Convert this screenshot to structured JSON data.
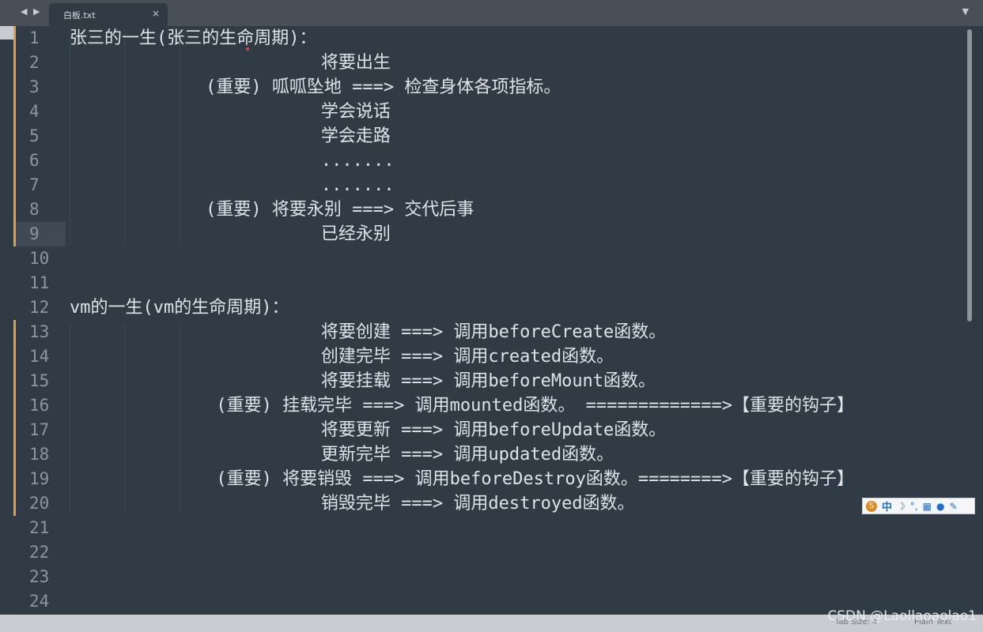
{
  "tab": {
    "nav": "◀ ▶",
    "filename": "白板.txt",
    "close": "×",
    "menu": "▼"
  },
  "lines": [
    {
      "n": "1",
      "t": "张三的一生(张三的生命周期)：",
      "mod": true
    },
    {
      "n": "2",
      "t": "                        将要出生",
      "mod": true
    },
    {
      "n": "3",
      "t": "             (重要) 呱呱坠地 ===> 检查身体各项指标。",
      "mod": true
    },
    {
      "n": "4",
      "t": "                        学会说话",
      "mod": true
    },
    {
      "n": "5",
      "t": "                        学会走路",
      "mod": true
    },
    {
      "n": "6",
      "t": "                        .......",
      "mod": true
    },
    {
      "n": "7",
      "t": "                        .......",
      "mod": true
    },
    {
      "n": "8",
      "t": "             (重要) 将要永别 ===> 交代后事",
      "mod": true
    },
    {
      "n": "9",
      "t": "                        已经永别",
      "mod": true,
      "cur": true
    },
    {
      "n": "10",
      "t": "",
      "mod": false
    },
    {
      "n": "11",
      "t": "",
      "mod": false
    },
    {
      "n": "12",
      "t": "vm的一生(vm的生命周期)：",
      "mod": false
    },
    {
      "n": "13",
      "t": "                        将要创建 ===> 调用beforeCreate函数。",
      "mod": true
    },
    {
      "n": "14",
      "t": "                        创建完毕 ===> 调用created函数。",
      "mod": true
    },
    {
      "n": "15",
      "t": "                        将要挂载 ===> 调用beforeMount函数。",
      "mod": true
    },
    {
      "n": "16",
      "t": "              (重要) 挂载完毕 ===> 调用mounted函数。 =============>【重要的钩子】",
      "mod": true
    },
    {
      "n": "17",
      "t": "                        将要更新 ===> 调用beforeUpdate函数。",
      "mod": true
    },
    {
      "n": "18",
      "t": "                        更新完毕 ===> 调用updated函数。",
      "mod": true
    },
    {
      "n": "19",
      "t": "              (重要) 将要销毁 ===> 调用beforeDestroy函数。========>【重要的钩子】",
      "mod": true
    },
    {
      "n": "20",
      "t": "                        销毁完毕 ===> 调用destroyed函数。",
      "mod": true
    },
    {
      "n": "21",
      "t": "",
      "mod": false
    },
    {
      "n": "22",
      "t": "",
      "mod": false
    },
    {
      "n": "23",
      "t": "",
      "mod": false
    },
    {
      "n": "24",
      "t": "",
      "mod": false
    }
  ],
  "ime": {
    "lang": "中"
  },
  "status": {
    "tab_size": "Tab Size: 4",
    "syntax": "Plain Text"
  },
  "watermark": "CSDN @Laollaoaolao1"
}
